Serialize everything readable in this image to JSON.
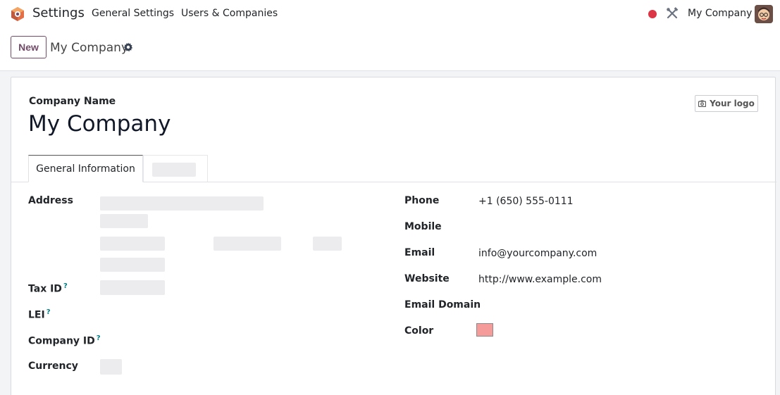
{
  "navbar": {
    "app_name": "Settings",
    "links": [
      "General Settings",
      "Users & Companies"
    ],
    "company": "My Company",
    "icons": [
      "odoo-logo-icon",
      "record-dot-icon",
      "debug-tools-icon",
      "avatar"
    ],
    "brand_color": "#714b67",
    "record_color": "#dc3545"
  },
  "control": {
    "new_label": "New",
    "breadcrumb": "My Company"
  },
  "form": {
    "company_name_label": "Company Name",
    "company_name": "My Company",
    "logo_label": "Your logo",
    "tabs": [
      "General Information"
    ],
    "left_fields": {
      "address_label": "Address",
      "tax_id_label": "Tax ID",
      "lei_label": "LEI",
      "company_id_label": "Company ID",
      "currency_label": "Currency",
      "help_marker": "?"
    },
    "right_fields": {
      "phone_label": "Phone",
      "phone": "+1 (650) 555-0111",
      "mobile_label": "Mobile",
      "email_label": "Email",
      "email": "info@yourcompany.com",
      "website_label": "Website",
      "website": "http://www.example.com",
      "email_domain_label": "Email Domain",
      "color_label": "Color",
      "color_value": "#f59c9b"
    }
  }
}
